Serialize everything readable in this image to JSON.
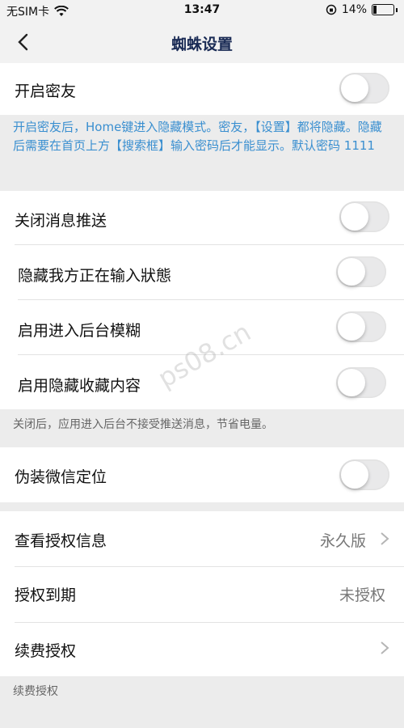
{
  "status_bar": {
    "carrier": "无SIM卡",
    "time": "13:47",
    "battery": "14%"
  },
  "nav": {
    "title": "蜘蛛设置"
  },
  "sections": {
    "mi_you": {
      "label": "开启密友",
      "enabled": false,
      "description": "开启密友后，Home键进入隐藏模式。密友，【设置】都将隐藏。隐藏后需要在首页上方【搜索框】输入密码后才能显示。默认密码 1111"
    },
    "push": {
      "items": [
        {
          "label": "关闭消息推送",
          "enabled": false
        },
        {
          "label": "隐藏我方正在输入狀態",
          "enabled": false
        },
        {
          "label": "启用进入后台模糊",
          "enabled": false
        },
        {
          "label": "启用隐藏收藏内容",
          "enabled": false
        }
      ],
      "footer": "关闭后，应用进入后台不接受推送消息，节省电量。"
    },
    "location": {
      "label": "伪装微信定位",
      "enabled": false
    },
    "license": {
      "items": [
        {
          "label": "查看授权信息",
          "value": "永久版"
        },
        {
          "label": "授权到期",
          "value": "未授权"
        },
        {
          "label": "续费授权",
          "value": ""
        }
      ],
      "footer": "续费授权"
    }
  },
  "watermark": "ps08.cn",
  "colors": {
    "accent_text": "#3a8fd0",
    "nav_title": "#1a2b55"
  }
}
